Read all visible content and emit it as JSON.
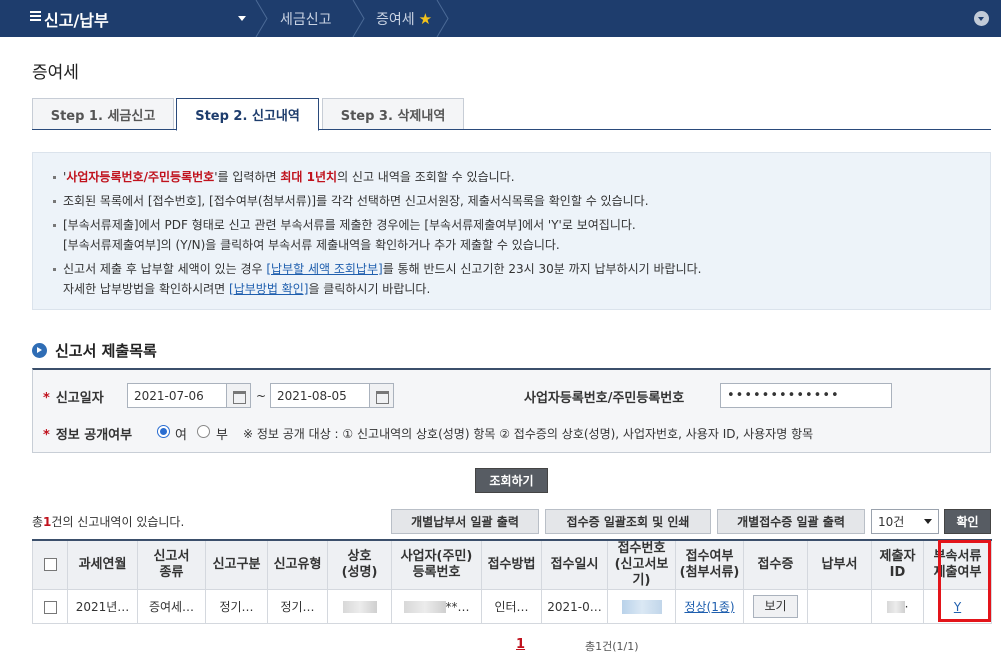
{
  "nav": {
    "menu_title": "신고/납부",
    "crumbs": [
      "세금신고",
      "증여세"
    ],
    "star_icon": "star-icon"
  },
  "page_title": "증여세",
  "tabs": [
    {
      "label": "Step 1. 세금신고"
    },
    {
      "label": "Step 2. 신고내역"
    },
    {
      "label": "Step 3. 삭제내역"
    }
  ],
  "info": {
    "l1_a": "'",
    "l1_red1": "사업자등록번호/주민등록번호",
    "l1_b": "'를 입력하면 ",
    "l1_red2": "최대 1년치",
    "l1_c": "의 신고 내역을 조회할 수 있습니다.",
    "l2": "조회된 목록에서 [접수번호], [접수여부(첨부서류)]를 각각 선택하면 신고서원장, 제출서식목록을 확인할 수 있습니다.",
    "l3": "[부속서류제출]에서 PDF 형태로 신고 관련 부속서류를 제출한 경우에는 [부속서류제출여부]에서 'Y'로 보여집니다.",
    "l4": "[부속서류제출여부]의 (Y/N)을 클릭하여 부속서류 제출내역을 확인하거나 추가 제출할 수 있습니다.",
    "l5_a": "신고서 제출 후 납부할 세액이 있는 경우 ",
    "l5_link": "[납부할 세액 조회납부]",
    "l5_b": "를 통해 반드시 신고기한 23시 30분 까지 납부하시기 바랍니다.",
    "l6_a": "자세한 납부방법을 확인하시려면 ",
    "l6_link": "[납부방법 확인]",
    "l6_b": "을 클릭하시기 바랍니다."
  },
  "section_title": "신고서 제출목록",
  "search": {
    "date_label": "신고일자",
    "date_from": "2021-07-06",
    "date_to": "2021-08-05",
    "tilde": "~",
    "biz_label": "사업자등록번호/주민등록번호",
    "biz_value": "•••••••••••••",
    "public_label": "정보 공개여부",
    "opt_yes": "여",
    "opt_no": "부",
    "note": "※ 정보 공개 대상 : ① 신고내역의 상호(성명) 항목 ② 접수증의 상호(성명), 사업자번호, 사용자 ID, 사용자명 항목",
    "search_button": "조회하기"
  },
  "list": {
    "count_prefix": "총",
    "count_num": "1",
    "count_suffix": "건의 신고내역이 있습니다.",
    "btn_print_bills": "개별납부서 일괄 출력",
    "btn_receipt_print": "접수증 일괄조회 및 인쇄",
    "btn_each_receipt": "개별접수증 일괄 출력",
    "page_size": "10건",
    "btn_ok": "확인"
  },
  "table": {
    "headers": [
      "",
      "과세연월",
      "신고서\n종류",
      "신고구분",
      "신고유형",
      "상호\n(성명)",
      "사업자(주민)\n등록번호",
      "접수방법",
      "접수일시",
      "접수번호\n(신고서보기)",
      "접수여부\n(첨부서류)",
      "접수증",
      "납부서",
      "제출자\nID",
      "부속서류\n제출여부"
    ],
    "row": {
      "period": "2021년…",
      "type": "증여세…",
      "division": "정기…",
      "kind": "정기…",
      "reg_suffix": "**…",
      "method": "인터…",
      "datetime": "2021-0…",
      "status": "정상(1종)",
      "see_button": "보기",
      "submitter_suffix": "·",
      "attach": "Y"
    }
  },
  "pager": {
    "current": "1",
    "total": "총1건(1/1)"
  }
}
